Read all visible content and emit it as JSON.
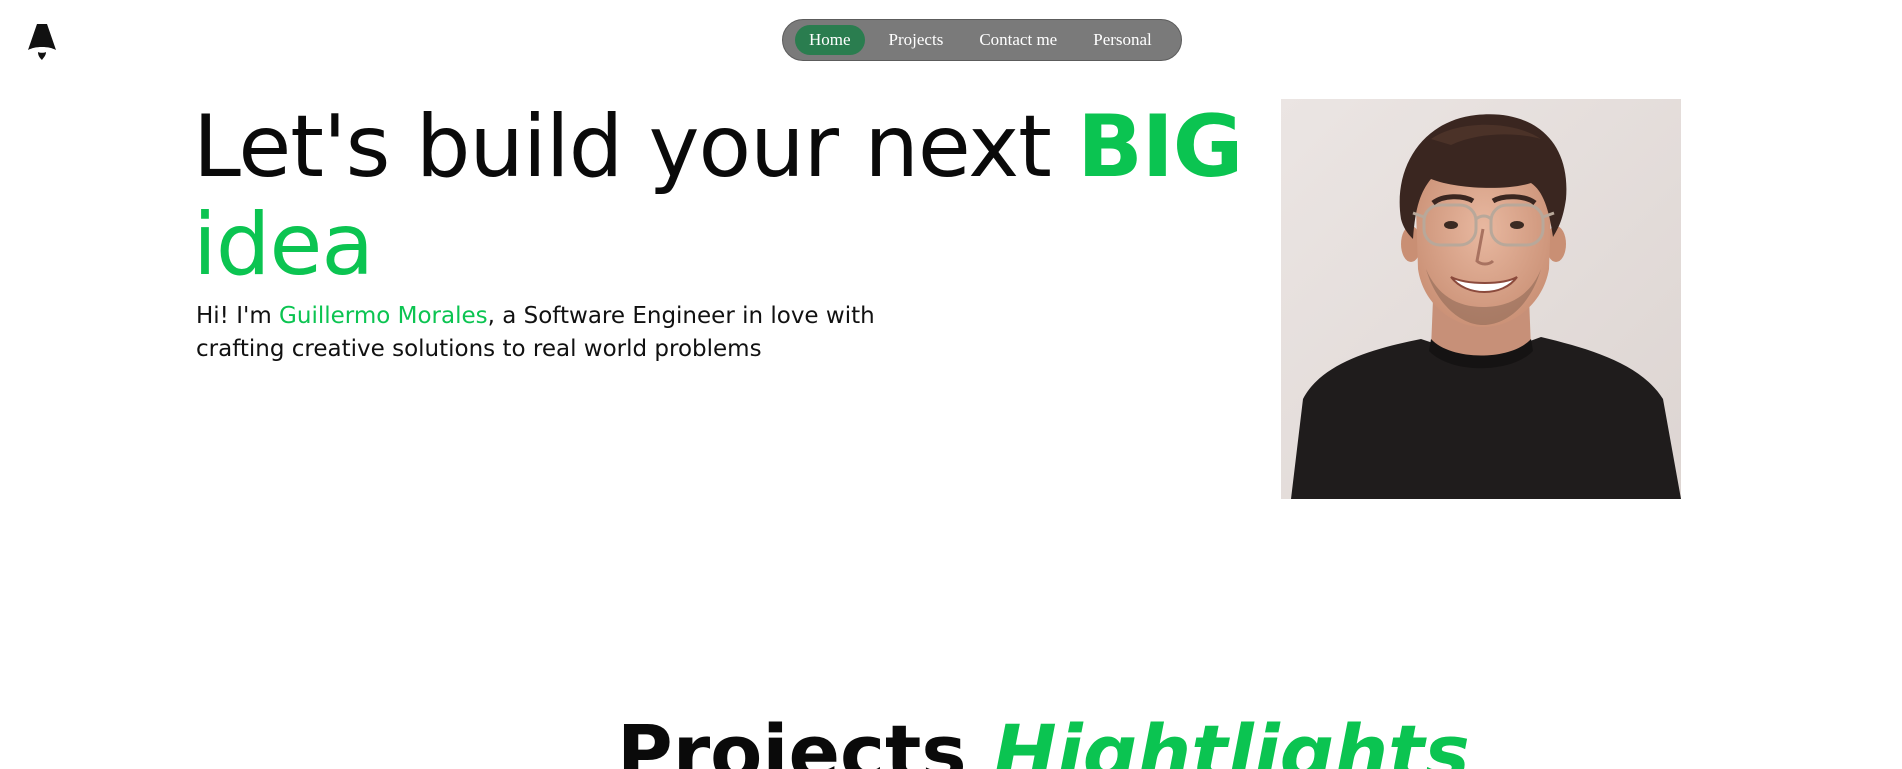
{
  "nav": {
    "items": [
      {
        "label": "Home",
        "active": true
      },
      {
        "label": "Projects",
        "active": false
      },
      {
        "label": "Contact me",
        "active": false
      },
      {
        "label": "Personal",
        "active": false
      }
    ]
  },
  "hero": {
    "title_start": "Let's build your next ",
    "title_big": "BIG",
    "title_idea": "idea",
    "intro_prefix": "Hi! I'm ",
    "intro_name": "Guillermo Morales",
    "intro_suffix": ", a Software Engineer in love with crafting creative solutions to real world problems"
  },
  "projects": {
    "heading_start": "Projects ",
    "heading_accent": "Hightlights"
  },
  "colors": {
    "accent": "#0bc451",
    "nav_background": "#7a7a7a",
    "nav_active": "#2a7d4f",
    "text": "#0a0a0a"
  },
  "icons": {
    "logo": "astro-logo-icon"
  }
}
